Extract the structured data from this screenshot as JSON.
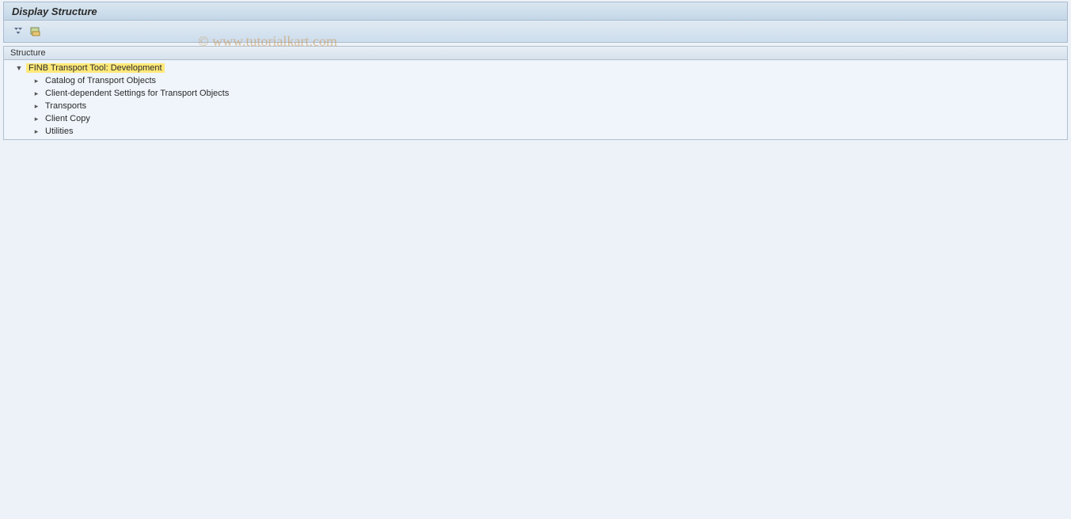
{
  "title": "Display Structure",
  "watermark": "© www.tutorialkart.com",
  "panel": {
    "header": "Structure"
  },
  "toolbar": {
    "expand_icon": "expand-all",
    "img_icon": "img-settings"
  },
  "tree": {
    "root": {
      "label": "FINB Transport Tool: Development",
      "expanded": true,
      "highlighted": true
    },
    "children": [
      {
        "label": "Catalog of Transport Objects"
      },
      {
        "label": "Client-dependent Settings for Transport Objects"
      },
      {
        "label": "Transports"
      },
      {
        "label": "Client Copy"
      },
      {
        "label": "Utilities"
      }
    ]
  }
}
